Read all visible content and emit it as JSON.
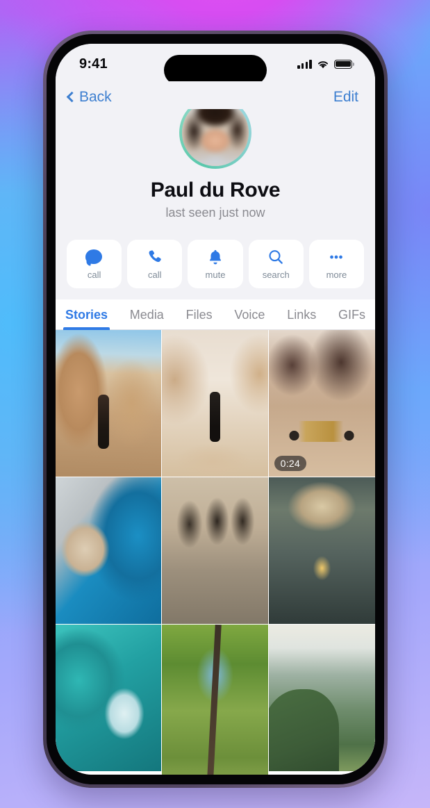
{
  "theme": {
    "accent_blue": "#2f7ae5",
    "link_blue": "#3d7fd0",
    "screen_bg": "#f2f2f6",
    "story_ring_green": "#59c8ac"
  },
  "status_bar": {
    "time": "9:41",
    "signal_icon": "cellular-bars-icon",
    "wifi_icon": "wifi-icon",
    "battery_icon": "battery-full-icon"
  },
  "nav": {
    "back_label": "Back",
    "edit_label": "Edit"
  },
  "profile": {
    "name": "Paul du Rove",
    "status": "last seen just now",
    "avatar_name": "profile-avatar",
    "has_story_ring": true
  },
  "actions": [
    {
      "label": "call",
      "icon": "message-bubble-icon"
    },
    {
      "label": "call",
      "icon": "phone-icon"
    },
    {
      "label": "mute",
      "icon": "bell-icon"
    },
    {
      "label": "search",
      "icon": "search-icon"
    },
    {
      "label": "more",
      "icon": "ellipsis-icon"
    }
  ],
  "tabs": [
    {
      "label": "Stories",
      "active": true
    },
    {
      "label": "Media",
      "active": false
    },
    {
      "label": "Files",
      "active": false
    },
    {
      "label": "Voice",
      "active": false
    },
    {
      "label": "Links",
      "active": false
    },
    {
      "label": "GIFs",
      "active": false
    }
  ],
  "stories": [
    {
      "alt": "man standing in desert canyon",
      "duration": ""
    },
    {
      "alt": "man standing on rock in pale desert",
      "duration": ""
    },
    {
      "alt": "motorbike parked in desert",
      "duration": "0:24"
    },
    {
      "alt": "french bulldog beside pool with green ball",
      "duration": ""
    },
    {
      "alt": "european street cafe with arches",
      "duration": ""
    },
    {
      "alt": "basilica interior dome",
      "duration": ""
    },
    {
      "alt": "parrot on teal fabric",
      "duration": ""
    },
    {
      "alt": "forest canopy looking up",
      "duration": ""
    },
    {
      "alt": "green mountain valley",
      "duration": ""
    }
  ]
}
